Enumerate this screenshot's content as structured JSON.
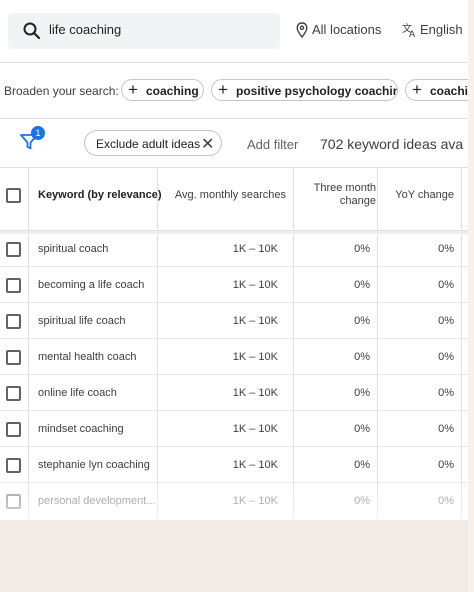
{
  "search": {
    "query": "life coaching"
  },
  "header": {
    "location_label": "All locations",
    "language_label": "English"
  },
  "broaden": {
    "label": "Broaden your search:",
    "chips": [
      "coaching",
      "positive psychology coaching",
      "coachin"
    ]
  },
  "filters": {
    "badge_count": "1",
    "exclude_chip_label": "Exclude adult ideas",
    "add_filter_label": "Add filter",
    "idea_count_text": "702 keyword ideas ava"
  },
  "table": {
    "headers": {
      "keyword": "Keyword (by relevance)",
      "avg": "Avg. monthly searches",
      "three_month_line1": "Three month",
      "three_month_line2": "change",
      "yoy": "YoY change"
    },
    "rows": [
      {
        "keyword": "spiritual coach",
        "avg": "1K – 10K",
        "three_month": "0%",
        "yoy": "0%"
      },
      {
        "keyword": "becoming a life coach",
        "avg": "1K – 10K",
        "three_month": "0%",
        "yoy": "0%"
      },
      {
        "keyword": "spiritual life coach",
        "avg": "1K – 10K",
        "three_month": "0%",
        "yoy": "0%"
      },
      {
        "keyword": "mental health coach",
        "avg": "1K – 10K",
        "three_month": "0%",
        "yoy": "0%"
      },
      {
        "keyword": "online life coach",
        "avg": "1K – 10K",
        "three_month": "0%",
        "yoy": "0%"
      },
      {
        "keyword": "mindset coaching",
        "avg": "1K – 10K",
        "three_month": "0%",
        "yoy": "0%"
      },
      {
        "keyword": "stephanie lyn coaching",
        "avg": "1K – 10K",
        "three_month": "0%",
        "yoy": "0%"
      },
      {
        "keyword": "personal development...",
        "avg": "1K – 10K",
        "three_month": "0%",
        "yoy": "0%"
      }
    ]
  },
  "colors": {
    "accent": "#1a73e8",
    "background": "#f1ebe6"
  },
  "icons": {
    "search": "search-icon",
    "location": "location-pin-icon",
    "language": "translate-icon",
    "filter": "filter-icon",
    "close": "close-icon",
    "plus": "plus-icon"
  }
}
